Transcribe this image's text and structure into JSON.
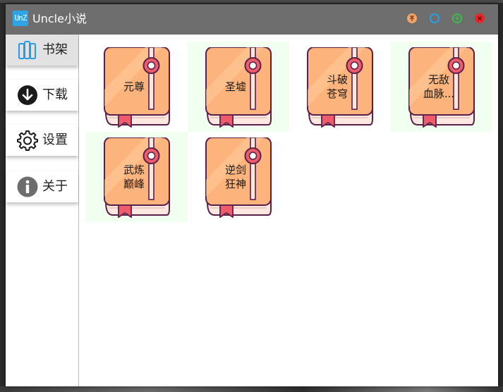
{
  "window": {
    "title": "Uncle小说",
    "app_icon_text": "UnZ"
  },
  "title_controls": [
    "pin-icon",
    "settings-icon",
    "maximize-icon",
    "close-icon"
  ],
  "sidebar": {
    "items": [
      {
        "label": "书架",
        "icon": "bookshelf-icon",
        "active": true
      },
      {
        "label": "下载",
        "icon": "download-icon",
        "active": false
      },
      {
        "label": "设置",
        "icon": "gear-icon",
        "active": false
      },
      {
        "label": "关于",
        "icon": "info-icon",
        "active": false
      }
    ]
  },
  "books": [
    {
      "title": "元尊",
      "highlighted": false
    },
    {
      "title": "圣墟",
      "highlighted": true
    },
    {
      "title": "斗破\n苍穹",
      "highlighted": false
    },
    {
      "title": "无敌\n血脉...",
      "highlighted": true
    },
    {
      "title": "武炼\n巅峰",
      "highlighted": true
    },
    {
      "title": "逆剑\n狂神",
      "highlighted": false
    }
  ],
  "colors": {
    "titlebar": "#6e6e6e",
    "book_cover": "#fdb37c",
    "book_outline": "#5b1f4a",
    "book_pages": "#fce8e0",
    "book_bookmark": "#ee5b6a",
    "highlight_bg": "#f0fff0"
  }
}
